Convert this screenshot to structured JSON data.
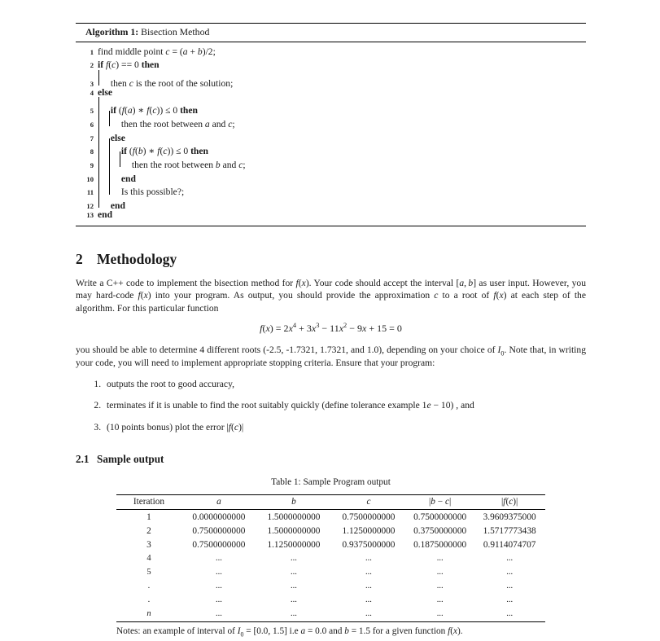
{
  "algorithm": {
    "caption_label": "Algorithm 1:",
    "caption_title": "Bisection Method",
    "lines": [
      {
        "n": "1",
        "text": "find middle point c = (a + b)/2;"
      },
      {
        "n": "2",
        "text": "if f(c) == 0 then"
      },
      {
        "n": "3",
        "text": "then c is the root of the solution;"
      },
      {
        "n": "4",
        "text": "else"
      },
      {
        "n": "5",
        "text": "if (f(a) * f(c)) ≤ 0 then"
      },
      {
        "n": "6",
        "text": "then the root between a and c;"
      },
      {
        "n": "7",
        "text": "else"
      },
      {
        "n": "8",
        "text": "if (f(b) * f(c)) ≤ 0 then"
      },
      {
        "n": "9",
        "text": "then the root between b and c;"
      },
      {
        "n": "10",
        "text": "end"
      },
      {
        "n": "11",
        "text": "Is this possible?;"
      },
      {
        "n": "12",
        "text": "end"
      },
      {
        "n": "13",
        "text": "end"
      }
    ]
  },
  "methodology": {
    "number": "2",
    "title": "Methodology",
    "paragraph1": "Write a C++ code to implement the bisection method for f(x). Your code should accept the interval [a, b] as user input. However, you may hard-code f(x) into your program. As output, you should provide the approximation c to a root of f(x) at each step of the algorithm. For this particular function",
    "equation": "f(x) = 2x⁴ + 3x³ − 11x² − 9x + 15 = 0",
    "paragraph2": "you should be able to determine 4 different roots (-2.5, -1.7321, 1.7321, and 1.0), depending on your choice of I₀. Note that, in writing your code, you will need to implement appropriate stopping criteria. Ensure that your program:",
    "requirements": [
      "outputs the root to good accuracy,",
      "terminates if it is unable to find the root suitably quickly (define tolerance example 1e − 10) , and",
      "(10 points bonus) plot the error |f(c)|"
    ]
  },
  "sample_output": {
    "number": "2.1",
    "title": "Sample output",
    "table_caption": "Table 1: Sample Program output",
    "columns": [
      "Iteration",
      "a",
      "b",
      "c",
      "|b − c|",
      "|f(c)|"
    ],
    "rows": [
      [
        "1",
        "0.0000000000",
        "1.5000000000",
        "0.7500000000",
        "0.7500000000",
        "3.9609375000"
      ],
      [
        "2",
        "0.7500000000",
        "1.5000000000",
        "1.1250000000",
        "0.3750000000",
        "1.5717773438"
      ],
      [
        "3",
        "0.7500000000",
        "1.1250000000",
        "0.9375000000",
        "0.1875000000",
        "0.9114074707"
      ],
      [
        "4",
        "...",
        "...",
        "...",
        "...",
        "..."
      ],
      [
        "5",
        "...",
        "...",
        "...",
        "...",
        "..."
      ],
      [
        ".",
        "...",
        "...",
        "...",
        "...",
        "..."
      ],
      [
        ".",
        "...",
        "...",
        "...",
        "...",
        "..."
      ],
      [
        "n",
        "...",
        "...",
        "...",
        "...",
        "..."
      ]
    ],
    "note": "Notes: an example of interval of I₀ = [0.0, 1.5] i.e a = 0.0 and b = 1.5 for a given function f(x)."
  }
}
